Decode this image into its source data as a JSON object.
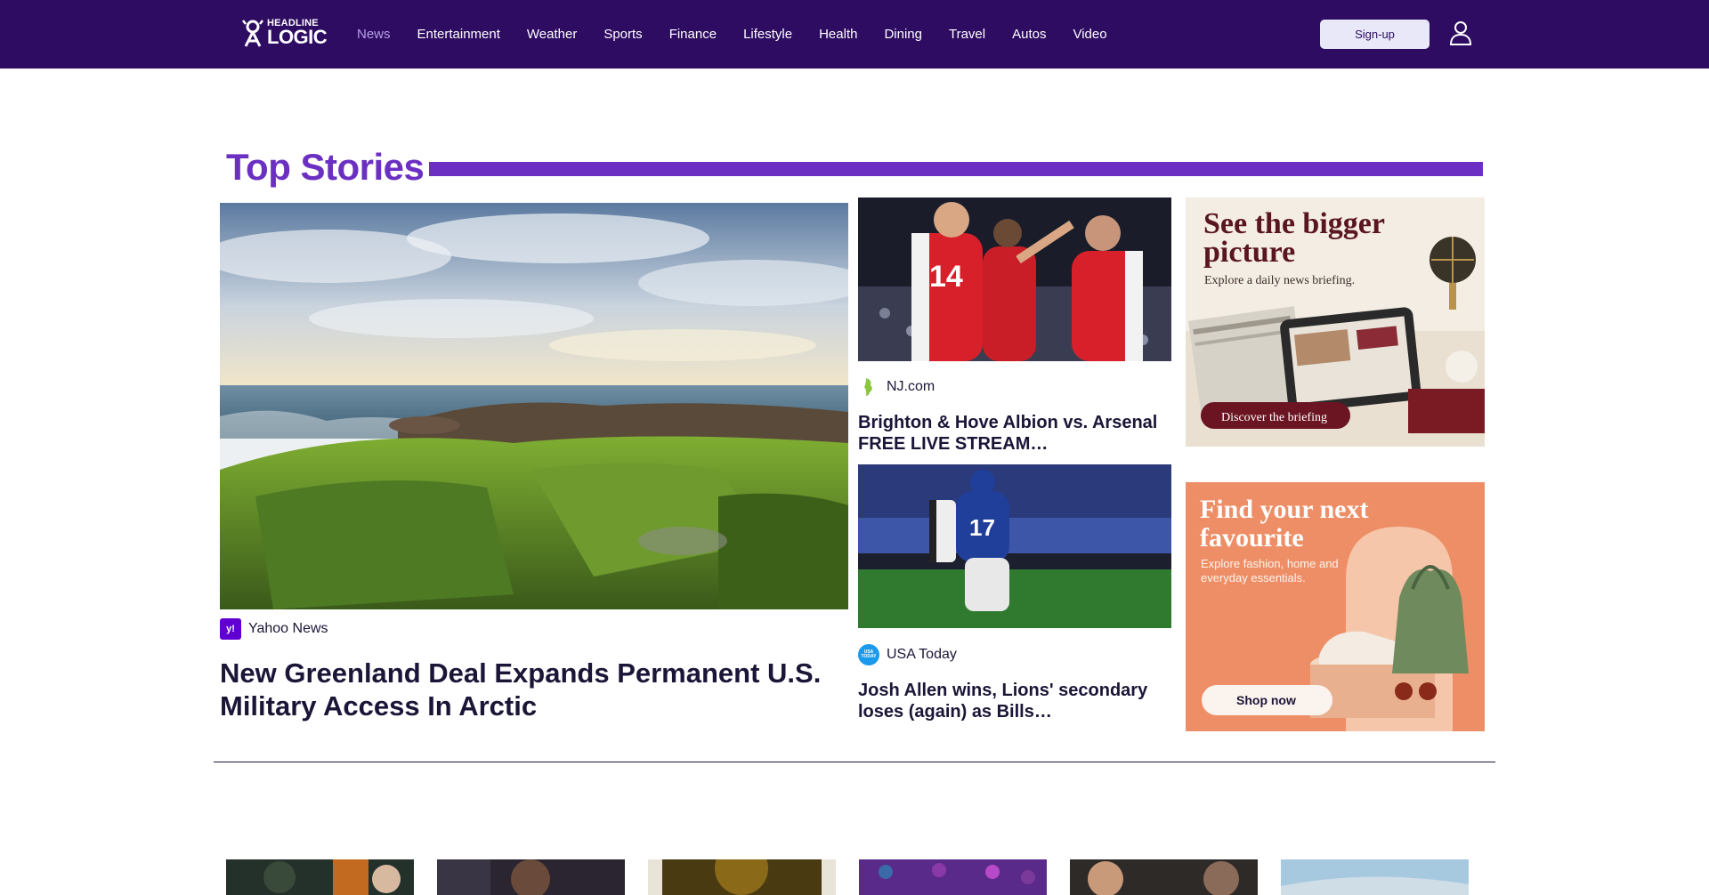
{
  "header": {
    "logo_small": "HEADLINE",
    "logo_big": "LOGIC",
    "nav": [
      "News",
      "Entertainment",
      "Weather",
      "Sports",
      "Finance",
      "Lifestyle",
      "Health",
      "Dining",
      "Travel",
      "Autos",
      "Video"
    ],
    "active_nav": "News",
    "signup_label": "Sign-up",
    "user_icon": "user-icon"
  },
  "section": {
    "title": "Top Stories"
  },
  "main_story": {
    "source": "Yahoo News",
    "source_logo_text": "y!",
    "headline": "New Greenland Deal Expands Permanent U.S. Military Access In Arctic"
  },
  "side_stories": [
    {
      "source": "NJ.com",
      "headline": "Brighton & Hove Albion vs. Arsenal FREE LIVE STREAM…",
      "jersey_text": "14"
    },
    {
      "source": "USA Today",
      "source_logo_text": "USA TODAY",
      "headline": "Josh Allen wins, Lions' secondary loses (again) as Bills…",
      "jersey_text": "17"
    }
  ],
  "ads": [
    {
      "title_line1": "See the bigger",
      "title_line2": "picture",
      "subtitle": "Explore a daily news briefing.",
      "cta": "Discover the briefing"
    },
    {
      "title_line1": "Find your next",
      "title_line2": "favourite",
      "subtitle_line1": "Explore fashion, home and",
      "subtitle_line2": "everyday essentials.",
      "cta": "Shop now"
    }
  ],
  "colors": {
    "header_bg": "#2e0c62",
    "accent": "#6b30c2",
    "active_nav": "#b6a2e8",
    "signup_bg": "#e8e8f8"
  }
}
